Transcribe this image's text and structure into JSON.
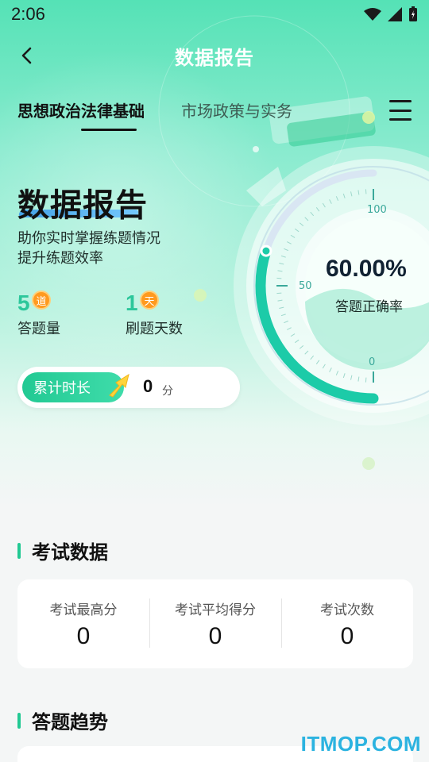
{
  "status_bar": {
    "time": "2:06"
  },
  "header": {
    "title": "数据报告"
  },
  "tabs": [
    {
      "label": "思想政治法律基础",
      "active": true
    },
    {
      "label": "市场政策与实务",
      "active": false
    }
  ],
  "report": {
    "title": "数据报告",
    "subtitle_line1": "助你实时掌握练题情况",
    "subtitle_line2": "提升练题效率"
  },
  "stats": [
    {
      "value": "5",
      "badge": "道",
      "label": "答题量"
    },
    {
      "value": "1",
      "badge": "天",
      "label": "刷题天数"
    }
  ],
  "duration": {
    "label": "累计时长",
    "value": "0",
    "unit": "分"
  },
  "gauge": {
    "accuracy": "60.00%",
    "accuracy_fraction": 0.6,
    "label": "答题正确率",
    "ticks": [
      "100",
      "50",
      "0"
    ]
  },
  "exam_section": {
    "title": "考试数据",
    "items": [
      {
        "label": "考试最高分",
        "value": "0"
      },
      {
        "label": "考试平均得分",
        "value": "0"
      },
      {
        "label": "考试次数",
        "value": "0"
      }
    ]
  },
  "trend_section": {
    "title": "答题趋势"
  },
  "watermark": "ITMOP.COM",
  "colors": {
    "accent": "#22c993",
    "badge": "#ff9a1f",
    "header_title": "#ffffff"
  }
}
